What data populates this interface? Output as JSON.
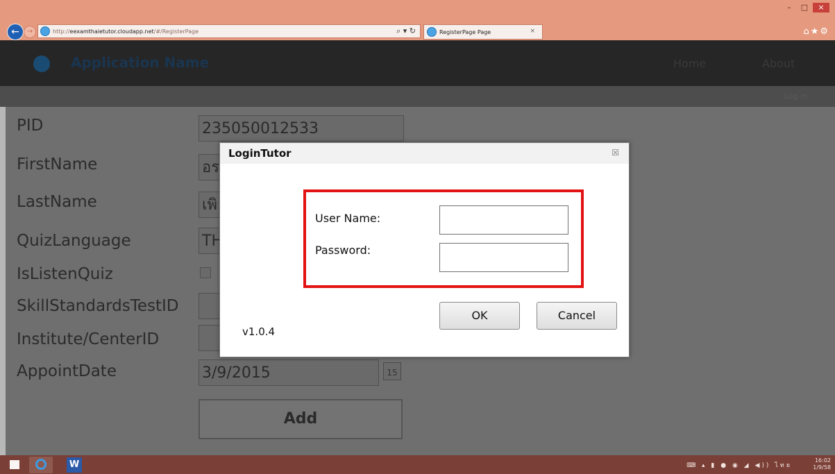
{
  "browser": {
    "url_prefix": "http://",
    "url_host": "eexamthaietutor.cloudapp.net",
    "url_path": "/#/RegisterPage",
    "address_tools": "⌕ ▾ ↻",
    "tab_title": "RegisterPage Page",
    "tab_close": "×",
    "right_icons": "⌂★⚙",
    "window_buttons": [
      "–",
      "□",
      "×"
    ]
  },
  "app": {
    "name": "Application Name",
    "nav": [
      "Home",
      "About"
    ],
    "sub_bar_text": "Log in"
  },
  "form": {
    "labels": [
      "PID",
      "FirstName",
      "LastName",
      "QuizLanguage",
      "IsListenQuiz",
      "SkillStandardsTestID",
      "Institute/CenterID",
      "AppointDate"
    ],
    "pid_value": "235050012533",
    "firstname_value": "อร",
    "lastname_value": "เพิ",
    "quizlanguage_value": "TH",
    "appointdate_value": "3/9/2015",
    "calendar_day": "15",
    "add_label": "Add"
  },
  "dialog": {
    "title": "LoginTutor",
    "close_glyph": "☒",
    "username_label": "User Name:",
    "password_label": "Password:",
    "ok_label": "OK",
    "cancel_label": "Cancel",
    "version": "v1.0.4",
    "highlight_color": "#e31212"
  },
  "taskbar": {
    "word_icon_text": "W",
    "tray_text": "⌨ ▴ ▮ ● ◉ ◢ ◀)) ไทย",
    "time": "16:02",
    "date": "1/9/58"
  }
}
